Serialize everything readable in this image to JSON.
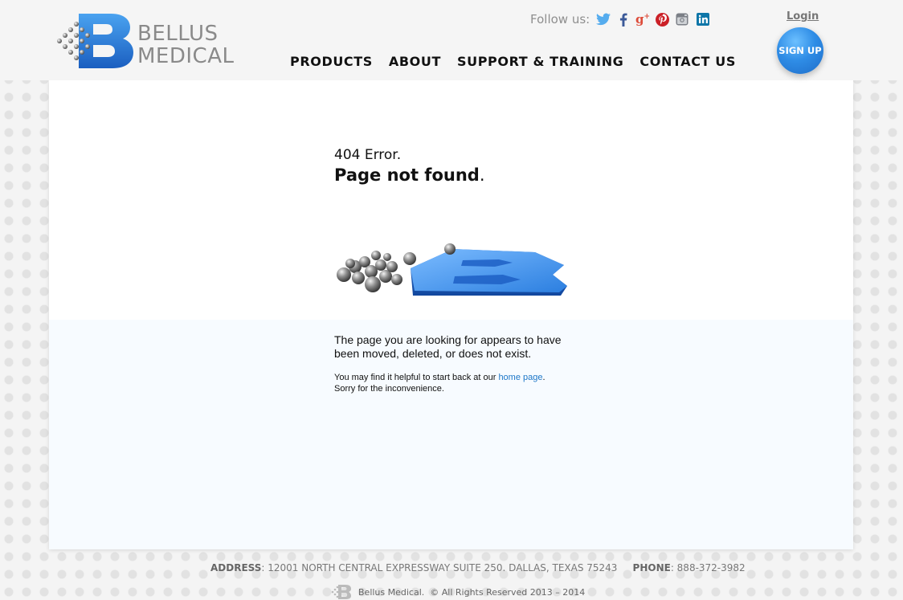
{
  "brand": {
    "line1": "BELLUS",
    "line2": "MEDICAL"
  },
  "header": {
    "follow_label": "Follow us:",
    "social_icons": [
      "twitter-icon",
      "facebook-icon",
      "google-plus-icon",
      "pinterest-icon",
      "instagram-icon",
      "linkedin-icon"
    ],
    "login_label": "Login",
    "signup_label": "SIGN UP"
  },
  "nav": {
    "items": [
      "PRODUCTS",
      "ABOUT",
      "SUPPORT & TRAINING",
      "CONTACT US"
    ]
  },
  "error": {
    "code": "404 Error.",
    "title": "Page not found",
    "title_end": ".",
    "message": "The page you are looking for appears to have been moved, deleted, or does not exist.",
    "help_prefix": "You may find it helpful to start back at our ",
    "help_link": "home page",
    "help_suffix": ".",
    "sorry": "Sorry for the inconvenience."
  },
  "footer": {
    "address_label": "ADDRESS",
    "address": ": 12001 NORTH CENTRAL EXPRESSWAY SUITE 250. DALLAS, TEXAS 75243",
    "phone_label": "PHONE",
    "phone": ": 888-372-3982",
    "company": "Bellus Medical.",
    "copyright": "© All Rights Reserved 2013 – 2014"
  },
  "colors": {
    "accent": "#2f8de6",
    "link": "#1e77c8",
    "twitter": "#55acee",
    "facebook": "#3b5998",
    "google": "#dd4b39",
    "pinterest": "#cb2027",
    "linkedin": "#0e76a8"
  }
}
